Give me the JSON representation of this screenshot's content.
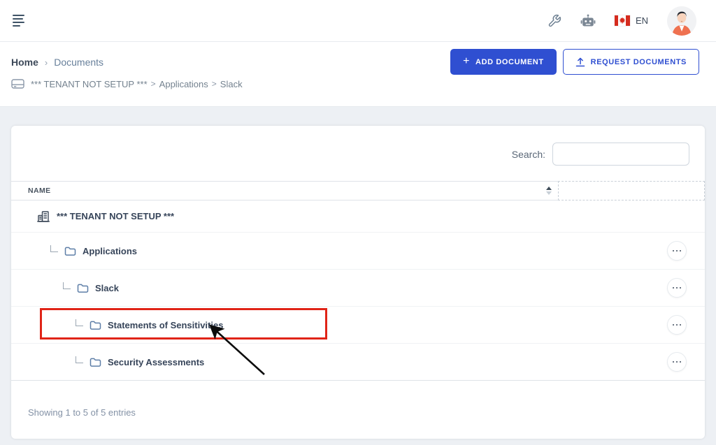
{
  "topbar": {
    "language": {
      "label": "EN"
    }
  },
  "breadcrumb": {
    "items": [
      "Home",
      "Documents"
    ],
    "separator": "›"
  },
  "location": {
    "segments": [
      "*** TENANT NOT SETUP ***",
      "Applications",
      "Slack"
    ],
    "separator": ">"
  },
  "actions": {
    "add_document": "ADD DOCUMENT",
    "request_documents": "REQUEST DOCUMENTS",
    "plus_glyph": "+"
  },
  "panel": {
    "search_label": "Search:",
    "search_value": "",
    "table": {
      "name_header": "NAME",
      "rows": [
        {
          "label": "*** TENANT NOT SETUP ***",
          "icon": "building",
          "indent": 0,
          "has_menu": false,
          "highlighted": false
        },
        {
          "label": "Applications",
          "icon": "folder",
          "indent": 1,
          "has_menu": true,
          "highlighted": false
        },
        {
          "label": "Slack",
          "icon": "folder",
          "indent": 2,
          "has_menu": true,
          "highlighted": false
        },
        {
          "label": "Statements of Sensitivities",
          "icon": "folder",
          "indent": 3,
          "has_menu": true,
          "highlighted": true
        },
        {
          "label": "Security Assessments",
          "icon": "folder",
          "indent": 3,
          "has_menu": true,
          "highlighted": false
        }
      ]
    },
    "footer_status": "Showing 1 to 5 of 5 entries"
  },
  "colors": {
    "primary": "#2f4fd1",
    "annotation_red": "#e02417",
    "flag_red": "#d52b1e",
    "folder_icon": "#5d7ea7"
  }
}
